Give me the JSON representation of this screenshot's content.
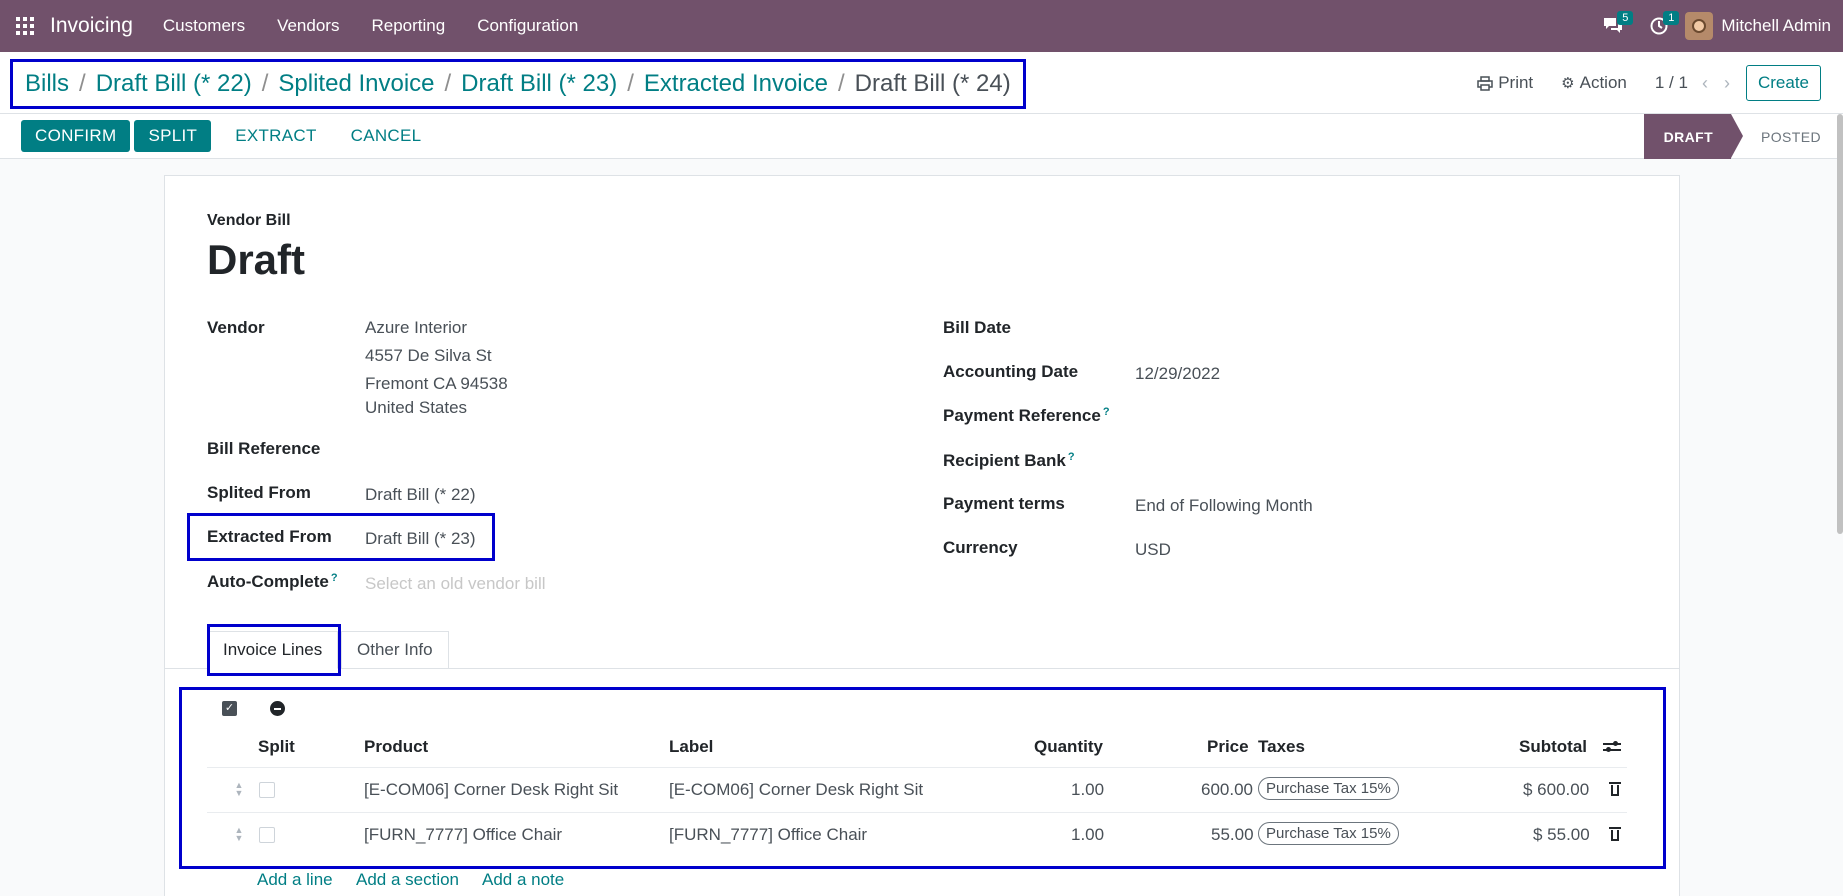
{
  "navbar": {
    "app_name": "Invoicing",
    "menu": [
      "Customers",
      "Vendors",
      "Reporting",
      "Configuration"
    ],
    "messages_count": "5",
    "activities_count": "1",
    "user_name": "Mitchell Admin"
  },
  "breadcrumbs": [
    "Bills",
    "Draft Bill (* 22)",
    "Splited Invoice",
    "Draft Bill (* 23)",
    "Extracted Invoice",
    "Draft Bill (* 24)"
  ],
  "control": {
    "print_label": "Print",
    "action_label": "Action",
    "pager": "1 / 1",
    "create_label": "Create"
  },
  "statusbar": {
    "buttons": [
      "CONFIRM",
      "SPLIT",
      "EXTRACT",
      "CANCEL"
    ],
    "stages": [
      "DRAFT",
      "POSTED"
    ],
    "active_stage": "DRAFT"
  },
  "form": {
    "doc_type": "Vendor Bill",
    "title": "Draft",
    "vendor_label": "Vendor",
    "vendor_name": "Azure Interior",
    "vendor_street": "4557 De Silva St",
    "vendor_city": "Fremont CA 94538",
    "vendor_country": "United States",
    "bill_reference_label": "Bill Reference",
    "splited_from_label": "Splited From",
    "splited_from_value": "Draft Bill (* 22)",
    "extracted_from_label": "Extracted From",
    "extracted_from_value": "Draft Bill (* 23)",
    "auto_complete_label": "Auto-Complete",
    "auto_complete_placeholder": "Select an old vendor bill",
    "bill_date_label": "Bill Date",
    "accounting_date_label": "Accounting Date",
    "accounting_date_value": "12/29/2022",
    "payment_reference_label": "Payment Reference",
    "recipient_bank_label": "Recipient Bank",
    "payment_terms_label": "Payment terms",
    "payment_terms_value": "End of Following Month",
    "currency_label": "Currency",
    "currency_value": "USD",
    "help_mark": "?"
  },
  "tabs": [
    "Invoice Lines",
    "Other Info"
  ],
  "lines": {
    "headers": {
      "split": "Split",
      "product": "Product",
      "label": "Label",
      "quantity": "Quantity",
      "price": "Price",
      "taxes": "Taxes",
      "subtotal": "Subtotal"
    },
    "rows": [
      {
        "product": "[E-COM06] Corner Desk Right Sit",
        "label": "[E-COM06] Corner Desk Right Sit",
        "quantity": "1.00",
        "price": "600.00",
        "tax": "Purchase Tax 15%",
        "subtotal": "$ 600.00"
      },
      {
        "product": "[FURN_7777] Office Chair",
        "label": "[FURN_7777] Office Chair",
        "quantity": "1.00",
        "price": "55.00",
        "tax": "Purchase Tax 15%",
        "subtotal": "$ 55.00"
      }
    ],
    "add_links": [
      "Add a line",
      "Add a section",
      "Add a note"
    ]
  }
}
